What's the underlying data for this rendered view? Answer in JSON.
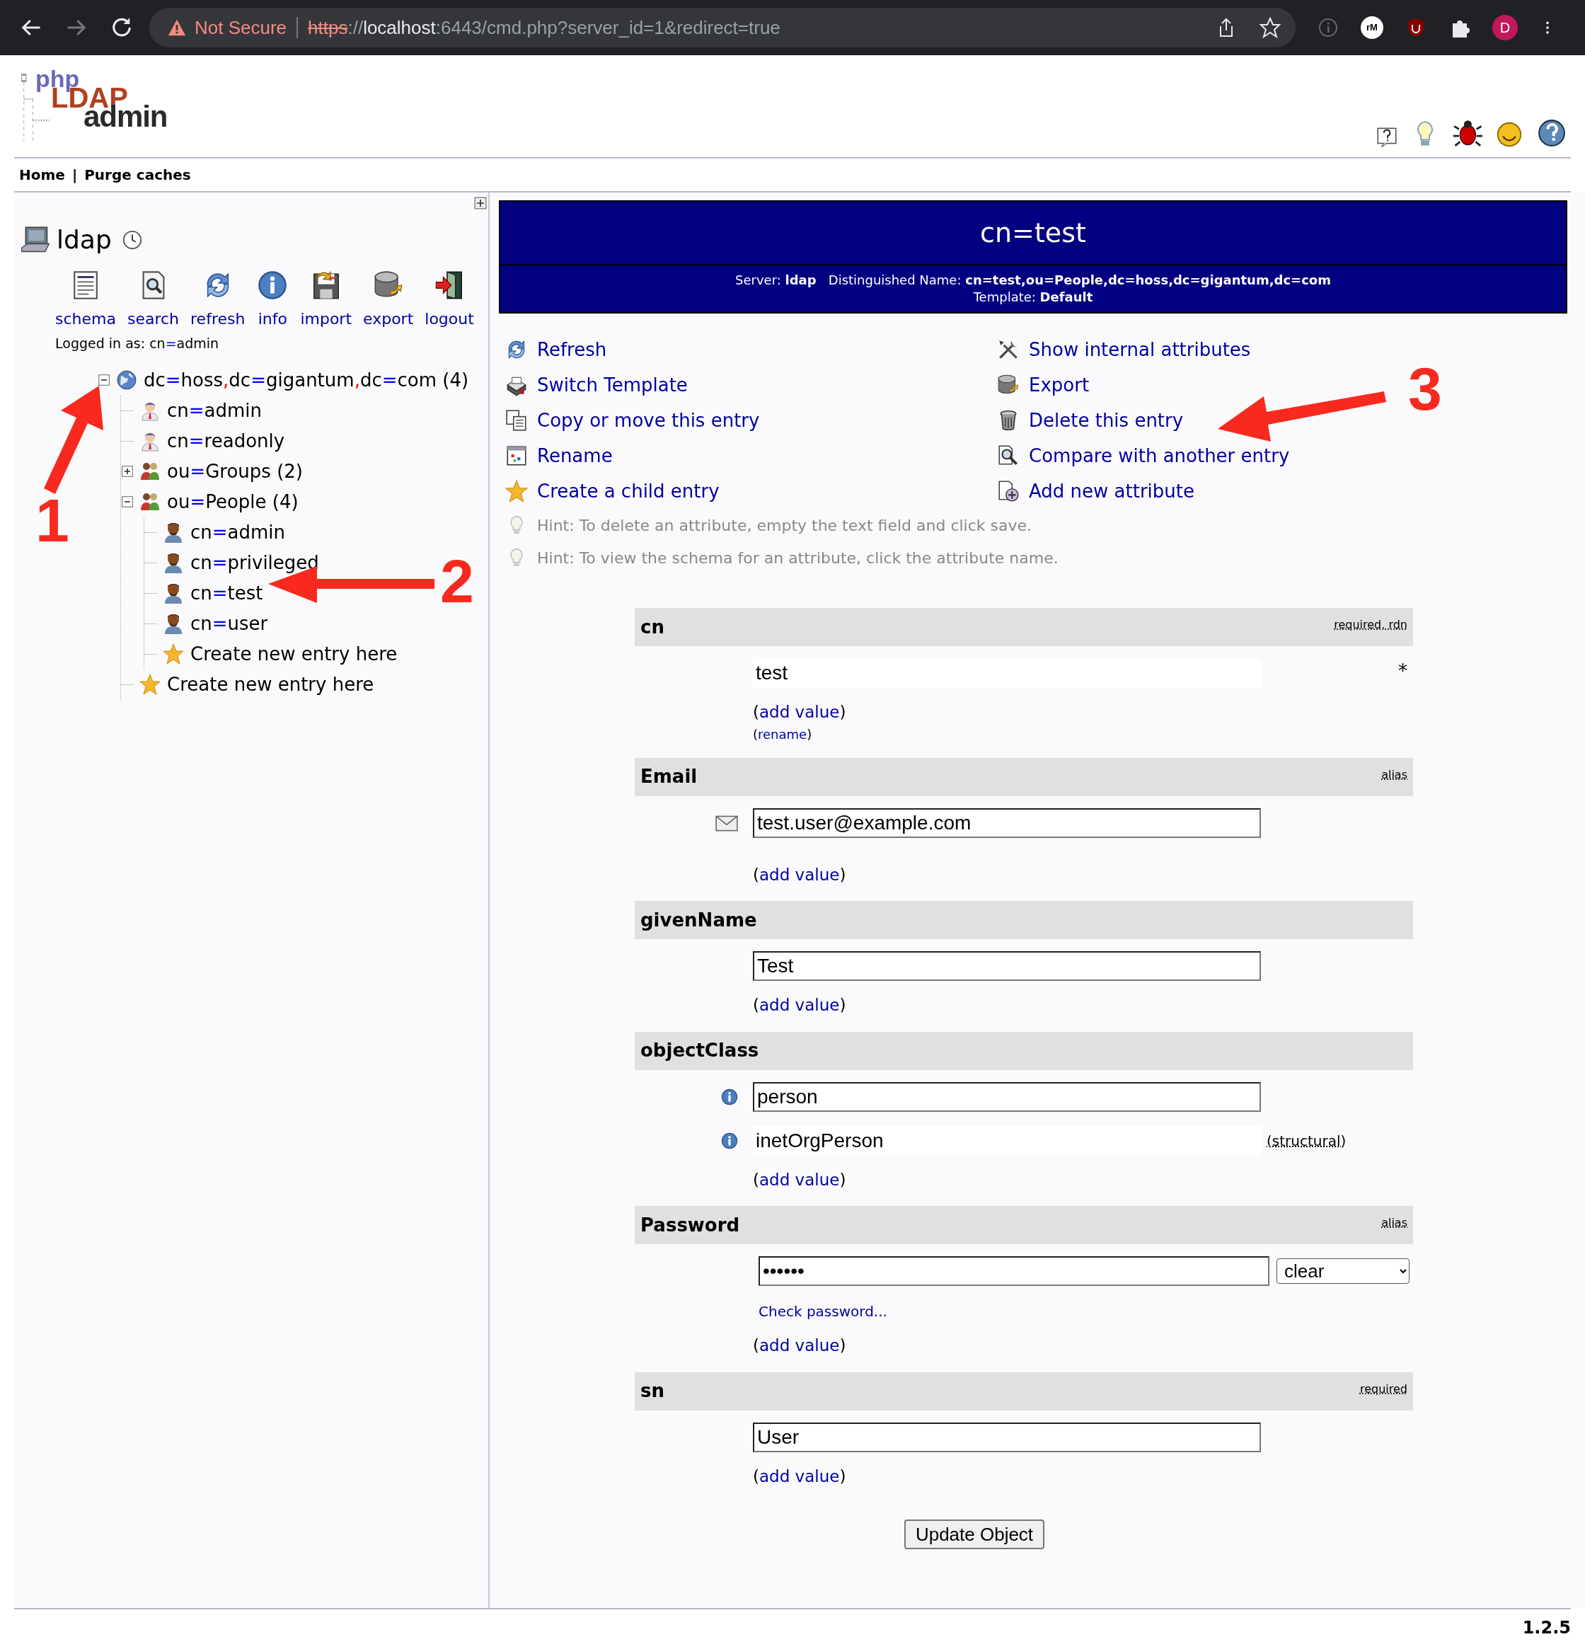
{
  "browser": {
    "warning": "Not Secure",
    "url": [
      {
        "kind": "scheme",
        "text": "https"
      },
      {
        "kind": "dim",
        "text": "://"
      },
      {
        "kind": "host",
        "text": "localhost"
      },
      {
        "kind": "dim",
        "text": ":6443/cmd.php?server_id=1&redirect=true"
      }
    ],
    "extension_badge": "rM",
    "profile_initial": "D"
  },
  "logo": {
    "top": "php",
    "middle": "LDAP",
    "bottom": "admin"
  },
  "nav": {
    "links": [
      "Home",
      "Purge caches"
    ],
    "separator": "|"
  },
  "server": {
    "name": "ldap",
    "logged_in": "Logged in as: cn=admin",
    "toolbar": [
      {
        "label": "schema"
      },
      {
        "label": "search"
      },
      {
        "label": "refresh"
      },
      {
        "label": "info"
      },
      {
        "label": "import"
      },
      {
        "label": "export"
      },
      {
        "label": "logout"
      }
    ]
  },
  "tree": [
    {
      "label": "dc=hoss,dc=gigantum,dc=com (4)",
      "kind": "domain",
      "expanded": true,
      "children": [
        {
          "label": "cn=admin",
          "kind": "admin"
        },
        {
          "label": "cn=readonly",
          "kind": "admin"
        },
        {
          "label": "ou=Groups (2)",
          "kind": "group",
          "expanded": false
        },
        {
          "label": "ou=People (4)",
          "kind": "group",
          "expanded": true,
          "children": [
            {
              "label": "cn=admin",
              "kind": "person"
            },
            {
              "label": "cn=privileged",
              "kind": "person"
            },
            {
              "label": "cn=test",
              "kind": "person"
            },
            {
              "label": "cn=user",
              "kind": "person"
            },
            {
              "label": "Create new entry here",
              "kind": "create"
            }
          ]
        },
        {
          "label": "Create new entry here",
          "kind": "create"
        }
      ]
    }
  ],
  "entry": {
    "title": "cn=test",
    "details": "Server: **ldap**   Distinguished Name: **cn=test,ou=People,dc=hoss,dc=gigantum,dc=com**",
    "template": "Template: **Default**"
  },
  "actions": [
    {
      "label": "Refresh"
    },
    {
      "label": "Show internal attributes"
    },
    {
      "label": "Switch Template"
    },
    {
      "label": "Export"
    },
    {
      "label": "Copy or move this entry"
    },
    {
      "label": "Delete this entry"
    },
    {
      "label": "Rename"
    },
    {
      "label": "Compare with another entry"
    },
    {
      "label": "Create a child entry"
    },
    {
      "label": "Add new attribute"
    }
  ],
  "hints": [
    "Hint: To delete an attribute, empty the text field and click save.",
    "Hint: To view the schema for an attribute, click the attribute name."
  ],
  "attributes": [
    {
      "name": "cn",
      "tags": "required, rdn",
      "values": [
        {
          "kind": "readonly",
          "value": "test",
          "marker": "*"
        }
      ],
      "add_value": "(add value)",
      "extra_link": "(rename)"
    },
    {
      "name": "Email",
      "tags": "alias",
      "values": [
        {
          "kind": "input",
          "value": "test.user@example.com"
        }
      ],
      "add_value": "(add value)"
    },
    {
      "name": "givenName",
      "values": [
        {
          "kind": "input",
          "value": "Test"
        }
      ],
      "add_value": "(add value)"
    },
    {
      "name": "objectClass",
      "values": [
        {
          "kind": "input",
          "value": "person"
        },
        {
          "kind": "readonly",
          "value": "inetOrgPerson",
          "note": "(structural)"
        }
      ],
      "add_value": "(add value)"
    },
    {
      "name": "Password",
      "tags": "alias",
      "values": [
        {
          "kind": "password",
          "value": "••••••",
          "encryption": "clear"
        }
      ],
      "check_link": "Check password...",
      "add_value": "(add value)"
    },
    {
      "name": "sn",
      "tags": "required",
      "values": [
        {
          "kind": "input",
          "value": "User"
        }
      ],
      "add_value": "(add value)"
    }
  ],
  "submit": "Update Object",
  "version": "1.2.5",
  "annotations": [
    {
      "number": "1"
    },
    {
      "number": "2"
    },
    {
      "number": "3"
    }
  ]
}
